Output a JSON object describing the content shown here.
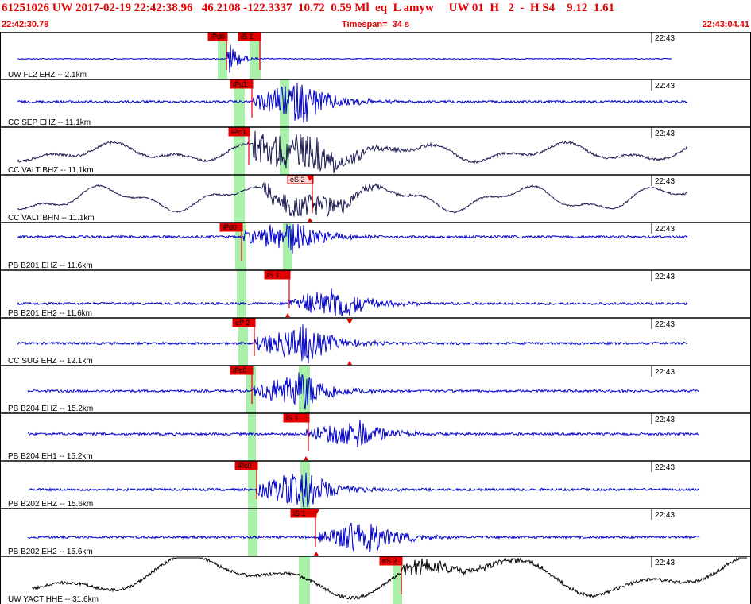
{
  "header": {
    "title": "61251026 UW 2017-02-19 22:42:38.96   46.2108 -122.3337  10.72  0.59 Ml  eq  L amyw     UW 01  H   2  -  H S4    9.12  1.61",
    "start_time": "22:42:30.78",
    "timespan": "Timespan=  34 s",
    "end_time": "22:43:04.41"
  },
  "colors": {
    "header_text": "#e00000",
    "trace_blue": "#0000c8",
    "trace_dark": "#1a1a50",
    "trace_black": "#000000",
    "pick": "#e00000",
    "pick_window": "#aaf0aa"
  },
  "panels": [
    {
      "label": "UW FL2 EHZ -- 2.1km",
      "time_tick": "22:43",
      "trace_color": "trace_blue",
      "picks": [
        {
          "label": "iPd0",
          "style": "solid"
        },
        {
          "label": "iS 1",
          "style": "solid"
        }
      ]
    },
    {
      "label": "CC SEP EHZ -- 11.1km",
      "time_tick": "22:43",
      "trace_color": "trace_blue",
      "picks": [
        {
          "label": "iPd1",
          "style": "solid"
        }
      ]
    },
    {
      "label": "CC VALT BHZ -- 11.1km",
      "time_tick": "22:43",
      "trace_color": "trace_dark",
      "picks": [
        {
          "label": "iPc0",
          "style": "solid"
        }
      ]
    },
    {
      "label": "CC VALT BHN -- 11.1km",
      "time_tick": "22:43",
      "trace_color": "trace_dark",
      "picks": [
        {
          "label": "eS 2",
          "style": "hollow"
        }
      ]
    },
    {
      "label": "PB B201 EHZ -- 11.6km",
      "time_tick": "22:43",
      "trace_color": "trace_blue",
      "picks": [
        {
          "label": "iPd0",
          "style": "solid"
        }
      ]
    },
    {
      "label": "PB B201 EH2 -- 11.6km",
      "time_tick": "22:43",
      "trace_color": "trace_blue",
      "picks": [
        {
          "label": "iS 1",
          "style": "solid"
        }
      ]
    },
    {
      "label": "CC SUG EHZ -- 12.1km",
      "time_tick": "22:43",
      "trace_color": "trace_blue",
      "picks": [
        {
          "label": "eP 2",
          "style": "solid"
        }
      ]
    },
    {
      "label": "PB B204 EHZ -- 15.2km",
      "time_tick": "22:43",
      "trace_color": "trace_blue",
      "picks": [
        {
          "label": "iPc0",
          "style": "solid"
        }
      ]
    },
    {
      "label": "PB B204 EH1 -- 15.2km",
      "time_tick": "22:43",
      "trace_color": "trace_blue",
      "picks": [
        {
          "label": "iS 1",
          "style": "solid"
        }
      ]
    },
    {
      "label": "PB B202 EHZ -- 15.6km",
      "time_tick": "22:43",
      "trace_color": "trace_blue",
      "picks": [
        {
          "label": "iPc0",
          "style": "solid"
        }
      ]
    },
    {
      "label": "PB B202 EH2 -- 15.6km",
      "time_tick": "22:43",
      "trace_color": "trace_blue",
      "picks": [
        {
          "label": "iS 1",
          "style": "solid"
        }
      ]
    },
    {
      "label": "UW YACT HHE -- 31.6km",
      "time_tick": "22:43",
      "trace_color": "trace_black",
      "picks": [
        {
          "label": "eS 2",
          "style": "solid"
        }
      ]
    }
  ]
}
